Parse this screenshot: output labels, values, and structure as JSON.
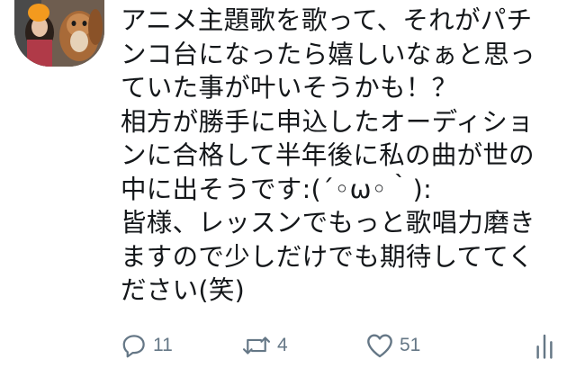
{
  "tweet": {
    "lines": [
      "アニメ主題歌を歌って、それがパチ",
      "ンコ台になったら嬉しいなぁと思っ",
      "ていた事が叶いそうかも！？",
      "相方が勝手に申込したオーディショ",
      "ンに合格して半年後に私の曲が世の",
      "中に出そうです:(´◦ω◦｀):",
      "皆様、レッスンでもっと歌唱力磨き",
      "ますので少しだけでも期待しててく",
      "ださい(笑)"
    ]
  },
  "actions": {
    "reply_count": "11",
    "retweet_count": "4",
    "like_count": "51"
  },
  "icons": {
    "reply": "reply-icon",
    "retweet": "retweet-icon",
    "like": "heart-icon",
    "analytics": "analytics-icon"
  },
  "colors": {
    "text": "#14171a",
    "icon": "#657786"
  }
}
